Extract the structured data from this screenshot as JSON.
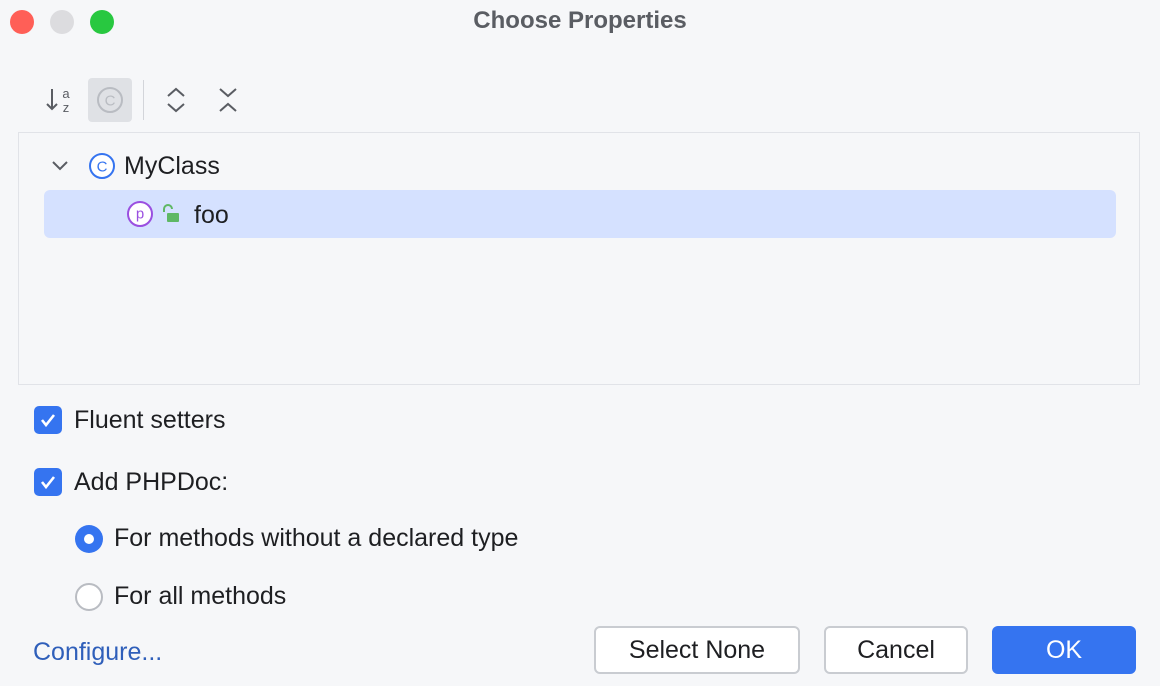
{
  "window": {
    "title": "Choose Properties",
    "traffic_lights": {
      "close": "#ff5f57",
      "minimize": "#dcdcdf",
      "zoom": "#28c840"
    }
  },
  "toolbar": {
    "sort_icon": "sort-alphabetically-icon",
    "sort_letters": {
      "top": "a",
      "bottom": "z"
    },
    "class_filter_icon": "show-classes-icon",
    "class_filter_letter": "C",
    "expand_icon": "expand-all-icon",
    "collapse_icon": "collapse-all-icon"
  },
  "tree": {
    "class_node": {
      "label": "MyClass",
      "icon": "class-icon",
      "icon_letter": "C",
      "expanded": true
    },
    "property_node": {
      "label": "foo",
      "icon": "property-icon",
      "icon_letter": "p",
      "visibility_icon": "public-unlock-icon",
      "selected": true
    }
  },
  "options": {
    "fluent_setters": {
      "label": "Fluent setters",
      "checked": true
    },
    "add_phpdoc": {
      "label": "Add PHPDoc:",
      "checked": true
    },
    "phpdoc_modes": [
      {
        "label": "For methods without a declared type",
        "selected": true
      },
      {
        "label": "For all methods",
        "selected": false
      }
    ]
  },
  "footer": {
    "configure_link": "Configure...",
    "select_none": "Select None",
    "cancel": "Cancel",
    "ok": "OK"
  },
  "colors": {
    "accent": "#3574f0",
    "selection": "#d5e1ff",
    "link": "#2f5fba",
    "property_purple": "#9a4fe0",
    "unlock_green": "#5fb865"
  }
}
